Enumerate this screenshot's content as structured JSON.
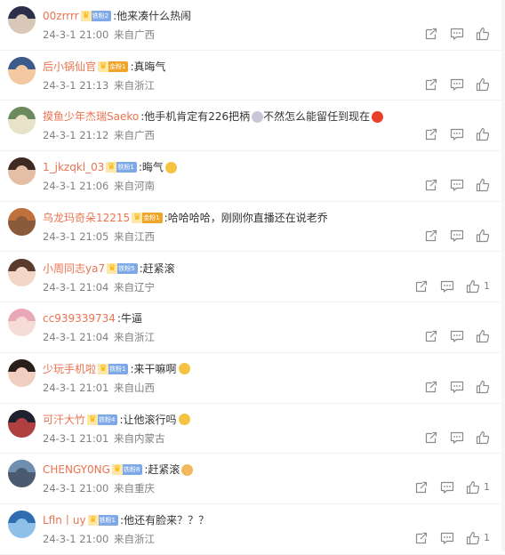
{
  "comments": [
    {
      "username": "00zrrrr",
      "badge": "铁粉2",
      "badge_color": "#7fa9e6",
      "text": ":他来凑什么热闹",
      "emoji": null,
      "time": "24-3-1 21:00",
      "source": "来自广西",
      "likes": "",
      "avatar_hair": "#2b2f4a",
      "avatar_face": "#d9c7b8"
    },
    {
      "username": "后小锅仙官",
      "badge": "金粉1",
      "badge_color": "#f0a52a",
      "text": ":真晦气",
      "emoji": null,
      "time": "24-3-1 21:13",
      "source": "来自浙江",
      "likes": "",
      "avatar_hair": "#3a5b8c",
      "avatar_face": "#f2c9a0"
    },
    {
      "username": "摸鱼少年杰瑞Saeko",
      "badge": null,
      "badge_color": null,
      "text": ":他手机肯定有226把柄",
      "emoji": "#c8c8d8",
      "text2": " 不然怎么能留任到现在",
      "emoji2": "#e8402a",
      "time": "24-3-1 21:12",
      "source": "来自广西",
      "likes": "",
      "avatar_hair": "#6c8a5b",
      "avatar_face": "#e8e2c8"
    },
    {
      "username": "1_jkzqkl_03",
      "badge": "铁粉1",
      "badge_color": "#7fa9e6",
      "text": ":晦气",
      "emoji": "#f5c242",
      "time": "24-3-1 21:06",
      "source": "来自河南",
      "likes": "",
      "avatar_hair": "#3d2a22",
      "avatar_face": "#e4bfa5"
    },
    {
      "username": "乌龙玛奇朵12215",
      "badge": "金粉1",
      "badge_color": "#f0a52a",
      "text": ":哈哈哈哈，刚刚你直播还在说老乔",
      "emoji": null,
      "time": "24-3-1 21:05",
      "source": "来自江西",
      "likes": "",
      "avatar_hair": "#c0703a",
      "avatar_face": "#8a5a3a"
    },
    {
      "username": "小周同志ya7",
      "badge": "铁粉5",
      "badge_color": "#7fa9e6",
      "text": ":赶紧滚",
      "emoji": null,
      "time": "24-3-1 21:04",
      "source": "来自辽宁",
      "likes": "1",
      "avatar_hair": "#5a3b2e",
      "avatar_face": "#f2d6c6"
    },
    {
      "username": "cc939339734",
      "badge": null,
      "badge_color": null,
      "text": ":牛逼",
      "emoji": null,
      "time": "24-3-1 21:04",
      "source": "来自浙江",
      "likes": "",
      "avatar_hair": "#e8a8b8",
      "avatar_face": "#f6dcd6"
    },
    {
      "username": "少玩手机啦",
      "badge": "铁粉1",
      "badge_color": "#7fa9e6",
      "text": ":来干嘛啊",
      "emoji": "#f5c242",
      "time": "24-3-1 21:01",
      "source": "来自山西",
      "likes": "",
      "avatar_hair": "#2a1e1a",
      "avatar_face": "#f0cfc0"
    },
    {
      "username": "可汗大竹",
      "badge": "铁粉4",
      "badge_color": "#7fa9e6",
      "text": ":让他滚行吗",
      "emoji": "#f5c242",
      "time": "24-3-1 21:01",
      "source": "来自内蒙古",
      "likes": "",
      "avatar_hair": "#1e2230",
      "avatar_face": "#b04040"
    },
    {
      "username": "CHENGY0NG",
      "badge": "铁粉8",
      "badge_color": "#7fa9e6",
      "text": ":赶紧滚",
      "emoji": "#f0b85a",
      "time": "24-3-1 21:00",
      "source": "来自重庆",
      "likes": "1",
      "avatar_hair": "#6f8fb0",
      "avatar_face": "#4a5a70"
    },
    {
      "username": "Lfln丨uy",
      "badge": "铁粉1",
      "badge_color": "#7fa9e6",
      "text": ":他还有脸来？？？",
      "emoji": null,
      "time": "24-3-1 21:00",
      "source": "来自浙江",
      "likes": "1",
      "avatar_hair": "#2f6cb0",
      "avatar_face": "#8fc0e8"
    }
  ],
  "icons": {
    "repost": "repost-icon",
    "comment": "comment-icon",
    "like": "like-icon",
    "crown": "crown-icon"
  },
  "colors": {
    "username": "#eb7350",
    "meta": "#808080",
    "text": "#333333",
    "icon": "#8a8a8a"
  }
}
